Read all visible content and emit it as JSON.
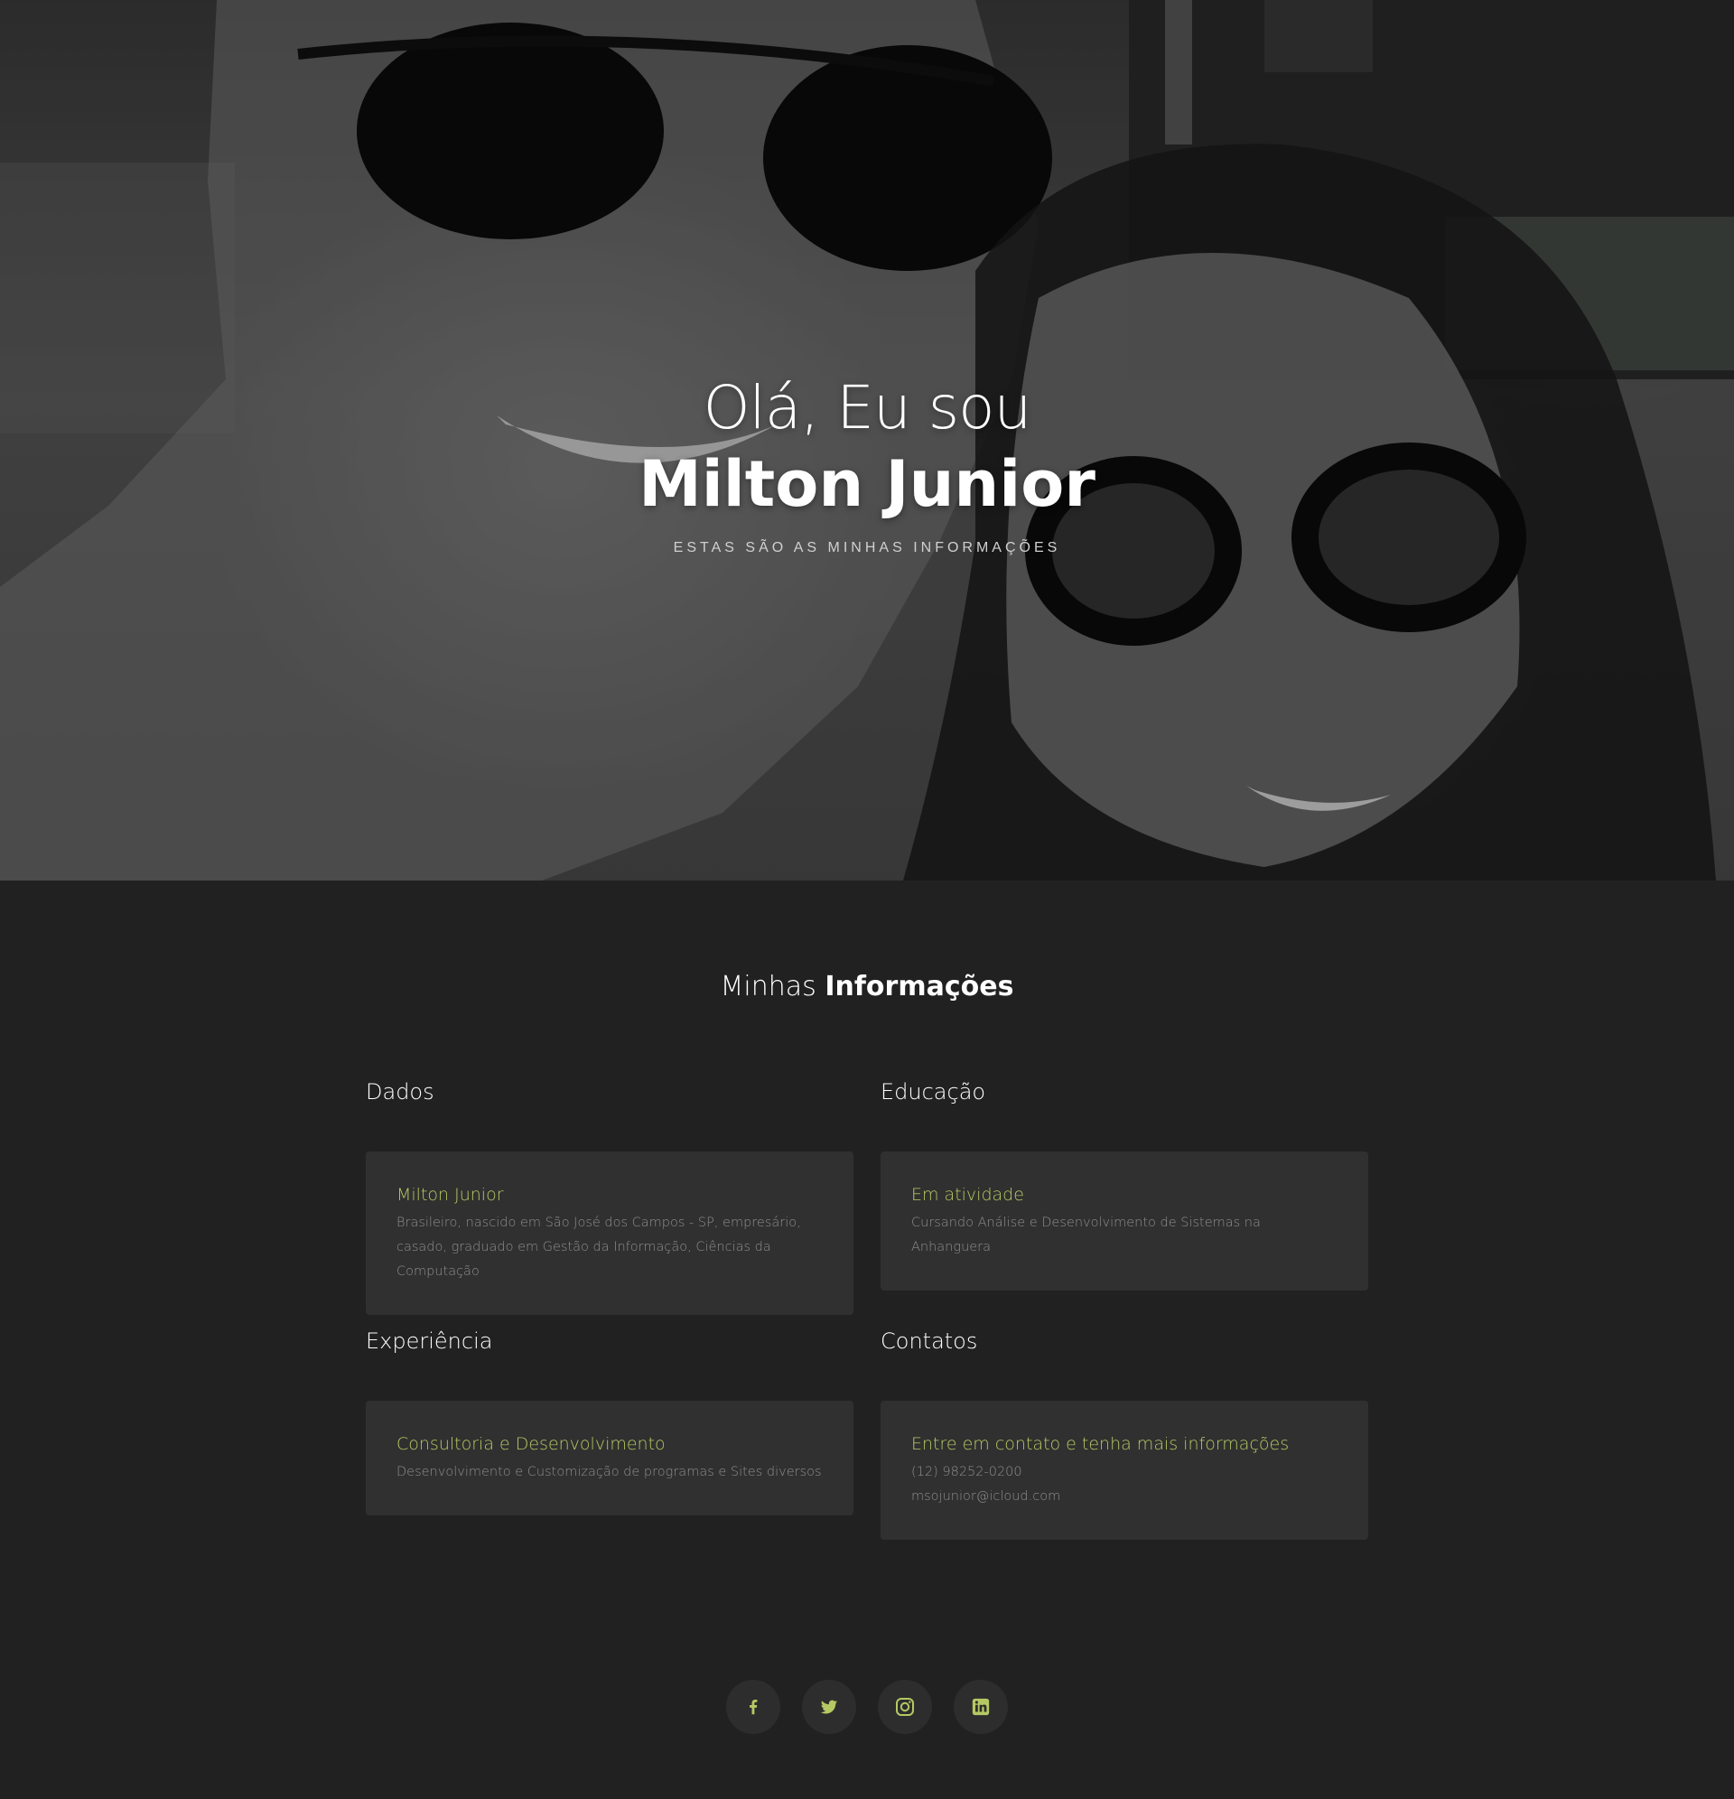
{
  "hero": {
    "greeting": "Olá, Eu sou",
    "name": "Milton Junior",
    "subtitle": "ESTAS SÃO AS MINHAS INFORMAÇÕES"
  },
  "info": {
    "title_light": "Minhas",
    "title_bold": "Informações",
    "sections": {
      "dados": {
        "heading": "Dados",
        "card_title": "Milton Junior",
        "card_text": "Brasileiro, nascido em São José dos Campos - SP, empresário, casado, graduado em Gestão da Informação, Ciências da Computação"
      },
      "educacao": {
        "heading": "Educação",
        "card_title": "Em atividade",
        "card_text": "Cursando Análise e Desenvolvimento de Sistemas na Anhanguera"
      },
      "experiencia": {
        "heading": "Experiência",
        "card_title": "Consultoria e Desenvolvimento",
        "card_text": "Desenvolvimento e Customização de programas e Sites diversos"
      },
      "contatos": {
        "heading": "Contatos",
        "card_title": "Entre em contato e tenha mais informações",
        "phone": "(12) 98252-0200",
        "email": "msojunior@icloud.com"
      }
    }
  },
  "social": [
    {
      "icon": "facebook-icon"
    },
    {
      "icon": "twitter-icon"
    },
    {
      "icon": "instagram-icon"
    },
    {
      "icon": "linkedin-icon"
    }
  ],
  "colors": {
    "background": "#212121",
    "card": "#303030",
    "accent": "#b5c963",
    "muted_text": "#8e8e8e",
    "social_button": "#2d2d2d"
  }
}
